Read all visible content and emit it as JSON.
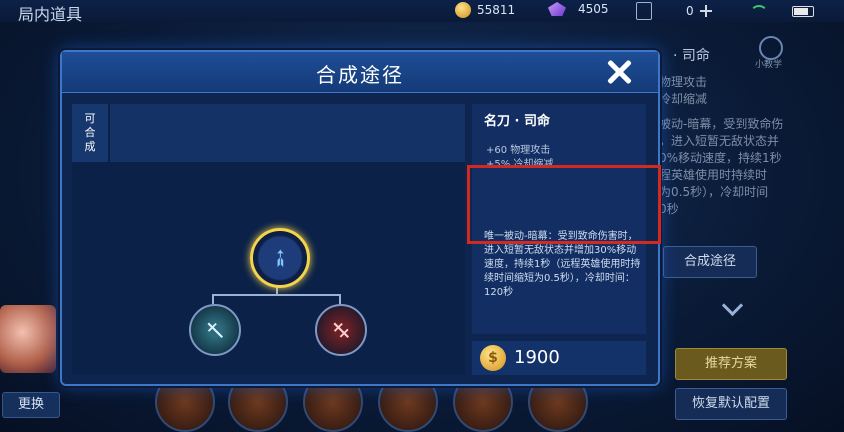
{
  "topbar": {
    "title": "局内道具",
    "gold": "55811",
    "gems": "4505",
    "tickets": "0"
  },
  "background": {
    "left_btn": "更换",
    "right_title": "· 司命",
    "right_desc": [
      "物理攻击",
      "冷却缩减",
      "被动-暗幕，受到致命伤",
      "，进入短暂无敌状态并",
      "0%移动速度，持续1秒",
      "程英雄使用时持续时",
      "为0.5秒），冷却时间",
      "0秒"
    ],
    "right_btn_path": "合成途径",
    "right_btn_recommend": "推荐方案",
    "right_btn_reset": "恢复默认配置",
    "right_mini": "小教学"
  },
  "dialog": {
    "title": "合成途径",
    "can_synth_label": "可合成",
    "item_name": "名刀 · 司命",
    "stats": [
      "+60 物理攻击",
      "+5% 冷却缩减"
    ],
    "passive": "唯一被动-暗幕：受到致命伤害时，进入短暂无敌状态并增加30%移动速度，持续1秒（远程英雄使用时持续时间缩短为0.5秒），冷却时间：120秒",
    "price": "1900"
  },
  "colors": {
    "accent": "#3e77c8",
    "highlight": "#d22a20",
    "selected_ring": "#f3d44a"
  },
  "icons": {
    "coin": "gold-coin-icon",
    "gem": "gem-icon",
    "close": "close-icon"
  }
}
